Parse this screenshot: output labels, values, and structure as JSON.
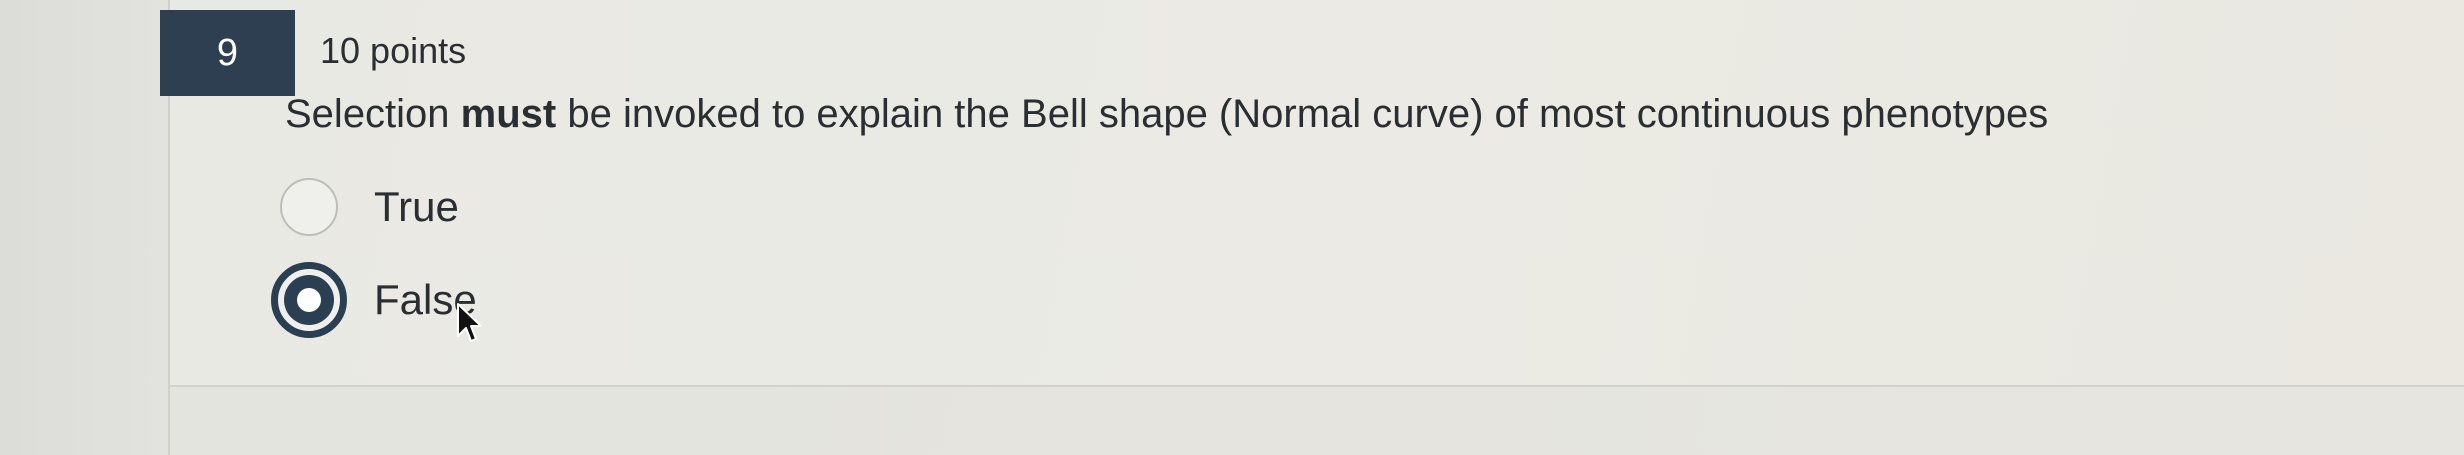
{
  "question": {
    "number": "9",
    "points": "10 points",
    "text_before": "Selection ",
    "text_emphasis": "must",
    "text_after": " be invoked to explain the Bell shape (Normal curve) of most continuous phenotypes"
  },
  "options": [
    {
      "label": "True",
      "selected": false
    },
    {
      "label": "False",
      "selected": true
    }
  ],
  "colors": {
    "badge": "#2d3f50",
    "selected_radio": "#2b3f52",
    "background": "#e9e8e2"
  }
}
